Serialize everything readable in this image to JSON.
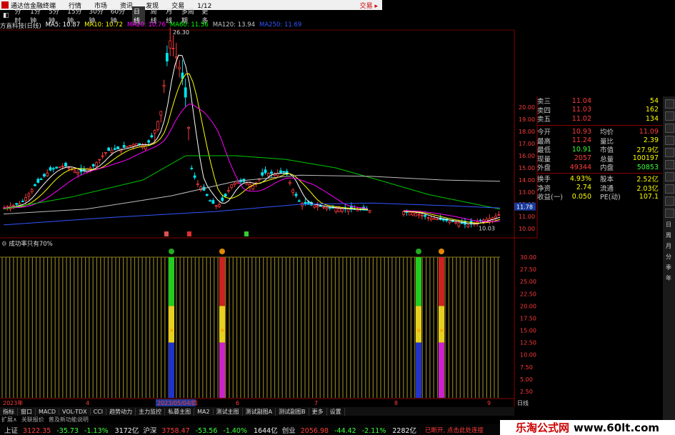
{
  "app": {
    "title": "通达信金融终端",
    "menu": [
      "行情",
      "市场",
      "资讯",
      "发现",
      "交易",
      "1/12"
    ],
    "trade_link": "交易 ▸"
  },
  "periods": [
    "分时",
    "1分钟",
    "5分钟",
    "15分钟",
    "30分钟",
    "60分钟",
    "日线",
    "周线",
    "月线",
    "多周期",
    "更多"
  ],
  "active_period": "日线",
  "stock": {
    "name_label": "方直科技(日线)",
    "ma": [
      {
        "label": "MA5: 10.87",
        "color": "#ffffff"
      },
      {
        "label": "MA10: 10.72",
        "color": "#ffff00"
      },
      {
        "label": "MA20: 10.76",
        "color": "#ff00ff"
      },
      {
        "label": "MA60: 11.56",
        "color": "#00ff00"
      },
      {
        "label": "MA120: 13.94",
        "color": "#c8c8c8"
      },
      {
        "label": "MA250: 11.69",
        "color": "#3355ff"
      }
    ],
    "high_mark": "26.30",
    "low_mark": "10.03",
    "last_price_tag": "11.78"
  },
  "price_axis": [
    "20.00",
    "19.00",
    "18.00",
    "17.00",
    "16.00",
    "15.00",
    "14.00",
    "13.00",
    "12.00",
    "11.00",
    "10.00"
  ],
  "indicator": {
    "name": "成功率只有70%",
    "axis": [
      "30.00",
      "27.50",
      "25.00",
      "22.50",
      "20.00",
      "17.50",
      "15.00",
      "12.50",
      "10.00",
      "7.50",
      "5.00",
      "2.50"
    ]
  },
  "date_axis": {
    "start": "2023年",
    "items": [
      "4",
      "2023/05/04/四",
      "6",
      "7",
      "8",
      "9"
    ],
    "period_label": "日线"
  },
  "quote": {
    "rows": [
      {
        "k": "卖三",
        "v": "11.04",
        "v2": "54"
      },
      {
        "k": "卖四",
        "v": "11.03",
        "v2": "162"
      },
      {
        "k": "卖五",
        "v": "11.02",
        "v2": "134"
      }
    ],
    "stats": [
      {
        "k": "今开",
        "v": "10.93",
        "k2": "均价",
        "v2": "11.09"
      },
      {
        "k": "最高",
        "v": "11.24",
        "k2": "量比",
        "v2": "2.39"
      },
      {
        "k": "最低",
        "v": "10.91",
        "k2": "市值",
        "v2": "27.9亿"
      },
      {
        "k": "现量",
        "v": "2057",
        "k2": "总量",
        "v2": "100197"
      },
      {
        "k": "外盘",
        "v": "49344",
        "k2": "内盘",
        "v2": "50853"
      },
      {
        "k": "换手",
        "v": "4.93%",
        "k2": "股本",
        "v2": "2.52亿"
      },
      {
        "k": "净资",
        "v": "2.74",
        "k2": "流通",
        "v2": "2.03亿"
      },
      {
        "k": "收益(一)",
        "v": "0.050",
        "k2": "PE(动)",
        "v2": "107.1"
      }
    ]
  },
  "side_chars": [
    "日",
    "周",
    "月",
    "分",
    "季",
    "年"
  ],
  "bottom_tabs": [
    "指标",
    "窗口",
    "MACD",
    "VOL-TDX",
    "CCI",
    "趋势动力",
    "主力监控",
    "私募主图",
    "MA2",
    "测试主图",
    "测试副图A",
    "测试副图B",
    "更多",
    "设置"
  ],
  "ext_tabs": [
    "扩展∧",
    "关联报价",
    "普及新功能说明"
  ],
  "status": [
    {
      "name": "上证",
      "price": "3122.35",
      "chg": "-35.73",
      "pct": "-1.13%",
      "vol": "3172亿"
    },
    {
      "name": "沪深",
      "price": "3758.47",
      "chg": "-53.56",
      "pct": "-1.40%",
      "vol": "1644亿"
    },
    {
      "name": "创业",
      "price": "2056.98",
      "chg": "-44.42",
      "pct": "-2.11%",
      "vol": "2282亿"
    }
  ],
  "status_note": "已断开, 点击此处连接",
  "watermark": {
    "cn": "乐淘公式网",
    "url": "www.60lt.com"
  }
}
